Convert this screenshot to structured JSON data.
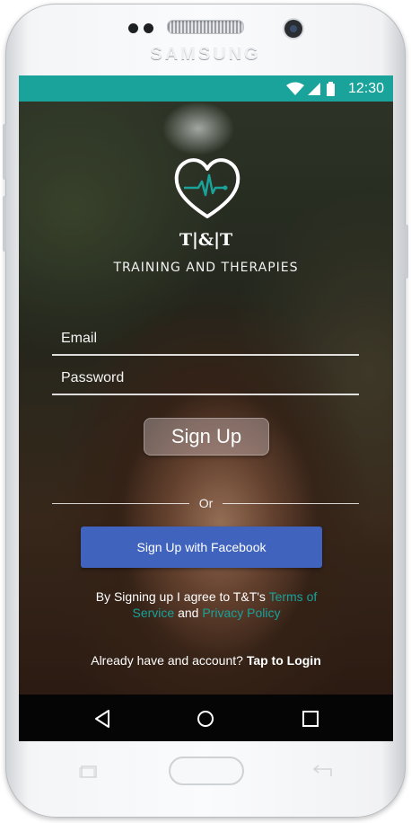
{
  "device": {
    "brand": "SAMSUNG"
  },
  "status_bar": {
    "time": "12:30",
    "icons": [
      "wifi-icon",
      "signal-icon",
      "battery-icon"
    ],
    "color": "#1aa39a"
  },
  "app": {
    "logo_icon": "heart-pulse-icon",
    "title": "T|&|T",
    "subtitle": "TRAINING AND THERAPIES"
  },
  "form": {
    "email_placeholder": "Email",
    "password_placeholder": "Password",
    "signup_label": "Sign Up"
  },
  "divider": {
    "text": "Or"
  },
  "facebook": {
    "label": "Sign Up with Facebook",
    "color": "#4064bd"
  },
  "terms": {
    "prefix": "By Signing up I agree to T&T's ",
    "terms_link": "Terms of Service",
    "conjunction": " and ",
    "privacy_link": "Privacy Policy",
    "link_color": "#17a29a"
  },
  "login": {
    "prompt": "Already have and account? ",
    "link": "Tap to Login"
  },
  "nav": {
    "icons": [
      "back-icon",
      "home-icon",
      "recents-icon"
    ]
  }
}
